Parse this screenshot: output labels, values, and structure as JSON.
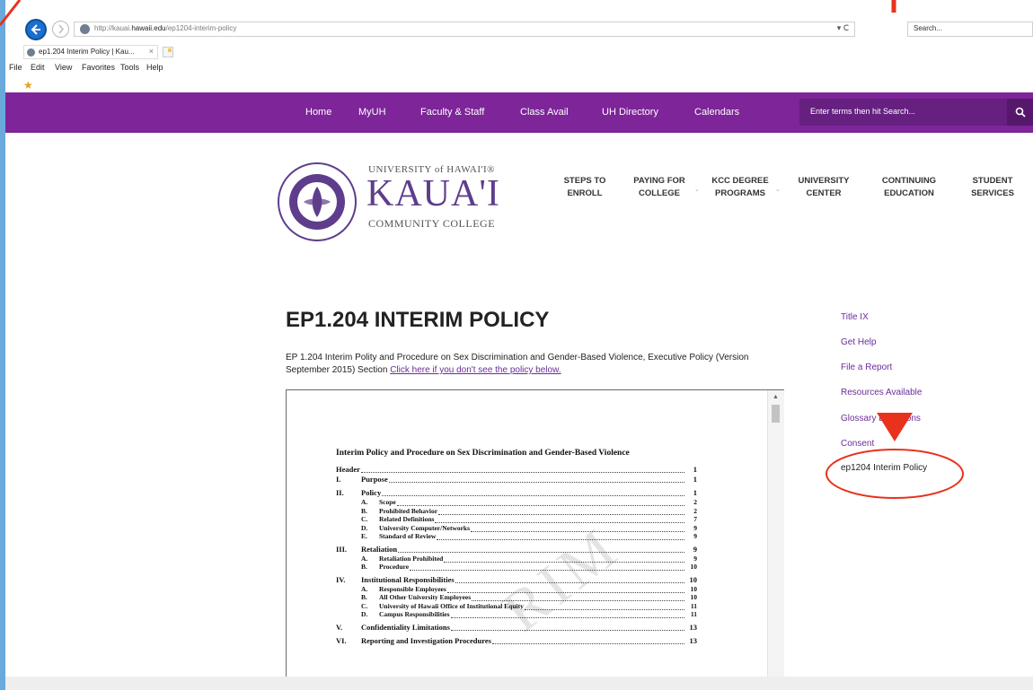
{
  "browser": {
    "url_prefix": "http://kauai.",
    "url_host": "hawaii.edu",
    "url_path": "/ep1204-interim-policy",
    "url_actions": "▾ Ⅽ",
    "search_placeholder": "Search...",
    "tab_title": "ep1.204 Interim Policy | Kau...",
    "tab_close": "×",
    "menu": [
      "File",
      "Edit",
      "View",
      "Favorites",
      "Tools",
      "Help"
    ]
  },
  "topnav": {
    "items": [
      "Home",
      "MyUH",
      "Faculty & Staff",
      "Class Avail",
      "UH Directory",
      "Calendars"
    ],
    "search_placeholder": "Enter terms then hit Search..."
  },
  "logo": {
    "univ": "UNIVERSITY of HAWAI'I®",
    "name": "KAUA'I",
    "college": "COMMUNITY COLLEGE"
  },
  "mainnav": [
    {
      "line1": "STEPS TO",
      "line2": "ENROLL"
    },
    {
      "line1": "PAYING FOR",
      "line2": "COLLEGE"
    },
    {
      "line1": "KCC DEGREE",
      "line2": "PROGRAMS"
    },
    {
      "line1": "UNIVERSITY",
      "line2": "CENTER"
    },
    {
      "line1": "CONTINUING",
      "line2": "EDUCATION"
    },
    {
      "line1": "STUDENT",
      "line2": "SERVICES"
    }
  ],
  "page": {
    "title": "EP1.204 INTERIM POLICY",
    "intro": "EP 1.204 Interim Polity and Procedure on Sex Discrimination and Gender-Based Violence, Executive Policy (Version September 2015) Section ",
    "intro_link": "Click here if you don't see the policy below."
  },
  "document": {
    "heading": "Interim Policy and Procedure on Sex Discrimination and Gender-Based Violence",
    "watermark": "RIM",
    "toc": [
      {
        "num": "",
        "label": "Header",
        "page": "1"
      },
      {
        "num": "I.",
        "label": "Purpose",
        "page": "1"
      },
      {
        "num": "II.",
        "label": "Policy",
        "page": "1"
      },
      {
        "sub": "A.",
        "label": "Scope",
        "page": "2"
      },
      {
        "sub": "B.",
        "label": "Prohibited Behavior",
        "page": "2"
      },
      {
        "sub": "C.",
        "label": "Related Definitions",
        "page": "7"
      },
      {
        "sub": "D.",
        "label": "University Computer/Networks",
        "page": "9"
      },
      {
        "sub": "E.",
        "label": "Standard of Review",
        "page": "9"
      },
      {
        "num": "III.",
        "label": "Retaliation",
        "page": "9"
      },
      {
        "sub": "A.",
        "label": "Retaliation Prohibited",
        "page": "9"
      },
      {
        "sub": "B.",
        "label": "Procedure",
        "page": "10"
      },
      {
        "num": "IV.",
        "label": "Institutional Responsibilities",
        "page": "10"
      },
      {
        "sub": "A.",
        "label": "Responsible Employees",
        "page": "10"
      },
      {
        "sub": "B.",
        "label": "All Other University Employees",
        "page": "10"
      },
      {
        "sub": "C.",
        "label": "University of Hawaii Office of Institutional Equity",
        "page": "11"
      },
      {
        "sub": "D.",
        "label": "Campus Responsibilities",
        "page": "11"
      },
      {
        "num": "V.",
        "label": "Confidentiality Limitations",
        "page": "13"
      },
      {
        "num": "VI.",
        "label": "Reporting and Investigation Procedures",
        "page": "13"
      }
    ]
  },
  "sidebar": {
    "links": [
      "Title IX",
      "Get Help",
      "File a Report",
      "Resources Available",
      "Glossary Definitions",
      "Consent",
      "ep1204 Interim Policy"
    ]
  },
  "colors": {
    "topbar": "#7d2599",
    "link": "#6b2c9a",
    "annotation": "#e8321e",
    "frame": "#6aa9dc"
  }
}
